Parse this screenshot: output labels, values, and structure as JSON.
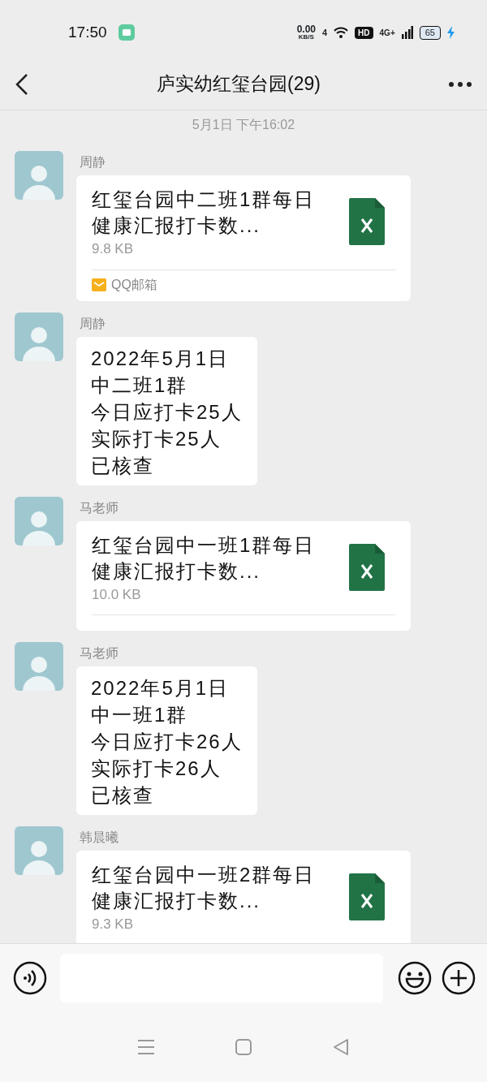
{
  "status_bar": {
    "time": "17:50",
    "net_speed": "0.00",
    "net_unit": "KB/S",
    "wifi_label": "4",
    "hd": "HD",
    "cell_label": "4G+",
    "battery": "65"
  },
  "header": {
    "title": "庐实幼红玺台园(29)"
  },
  "timestamp": "5月1日 下午16:02",
  "messages": [
    {
      "kind": "file",
      "sender": "周静",
      "title": "红玺台园中二班1群每日健康汇报打卡数...",
      "size": "9.8 KB",
      "source": "QQ邮箱"
    },
    {
      "kind": "text",
      "sender": "周静",
      "lines": [
        "2022年5月1日",
        "中二班1群",
        "今日应打卡25人",
        "实际打卡25人",
        "已核查"
      ]
    },
    {
      "kind": "file",
      "sender": "马老师",
      "title": "红玺台园中一班1群每日健康汇报打卡数...",
      "size": "10.0 KB"
    },
    {
      "kind": "text",
      "sender": "马老师",
      "lines": [
        "2022年5月1日",
        "中一班1群",
        "今日应打卡26人",
        "实际打卡26人",
        "已核查"
      ]
    },
    {
      "kind": "file",
      "sender": "韩晨曦",
      "title": "红玺台园中一班2群每日健康汇报打卡数...",
      "size": "9.3 KB"
    }
  ]
}
